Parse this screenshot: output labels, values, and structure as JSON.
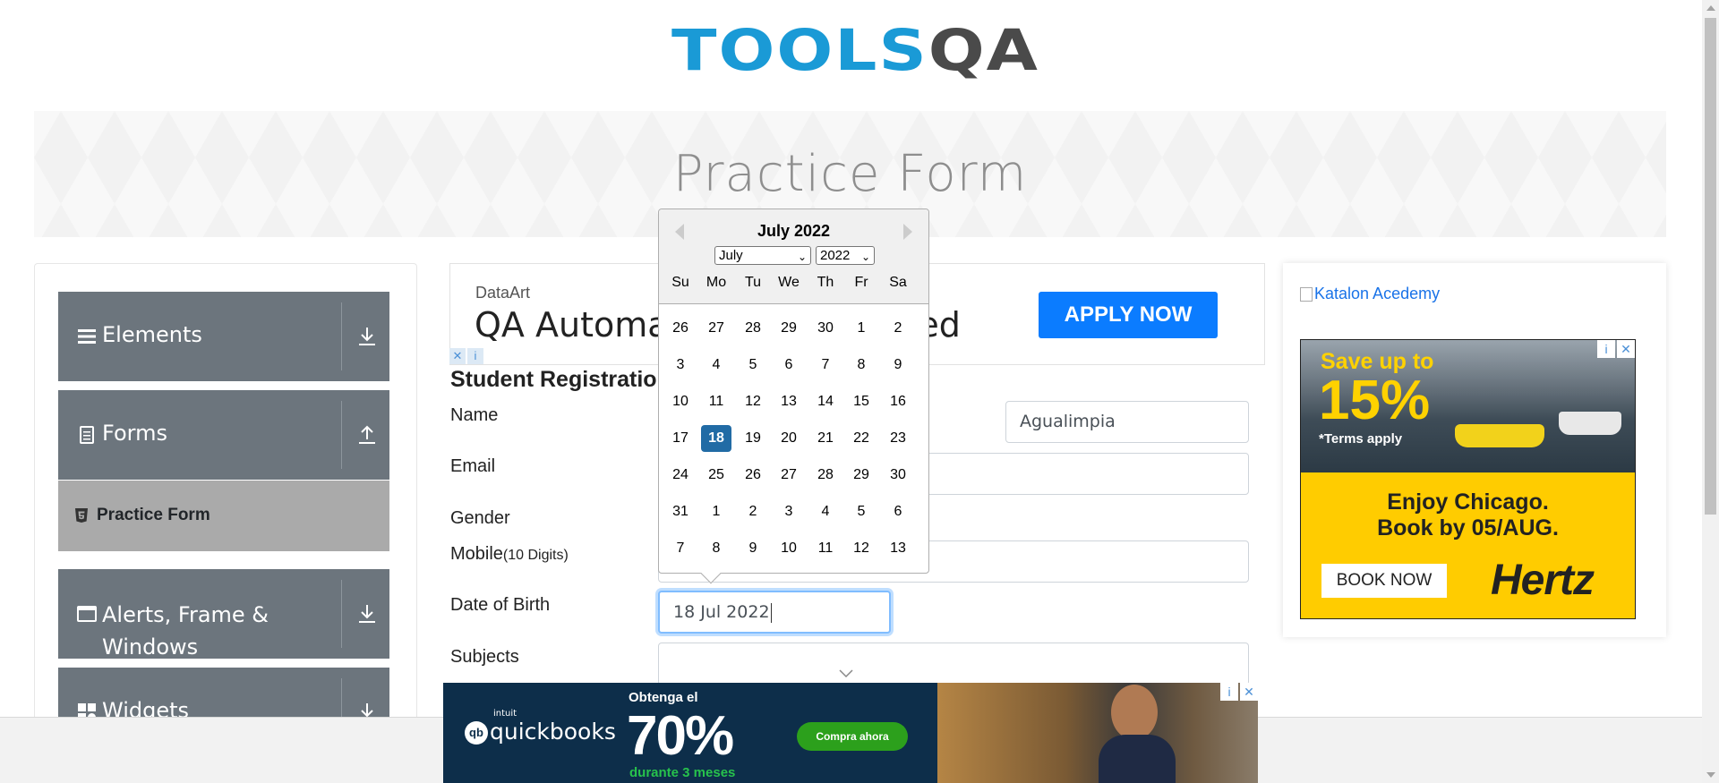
{
  "logo": {
    "text_a": "TOOLS",
    "text_b": "QA"
  },
  "banner": {
    "title": "Practice Form"
  },
  "sidebar": {
    "groups": [
      {
        "label": "Elements",
        "icon": "hamburger-icon",
        "state": "collapsed"
      },
      {
        "label": "Forms",
        "icon": "document-icon",
        "state": "expanded"
      },
      {
        "label": "Alerts, Frame & Windows",
        "label_line1": "Alerts, Frame &",
        "label_line2": "Windows",
        "icon": "window-icon",
        "state": "collapsed"
      },
      {
        "label": "Widgets",
        "icon": "widgets-icon",
        "state": "collapsed"
      }
    ],
    "active_item": {
      "label": "Practice Form",
      "icon": "html5-icon"
    }
  },
  "top_ad": {
    "brand": "DataArt",
    "headline_left": "QA Automat",
    "headline_right": "nted",
    "cta": "APPLY NOW",
    "adchoices": [
      "✕",
      "i"
    ]
  },
  "form": {
    "title": "Student Registration",
    "labels": {
      "name": "Name",
      "email": "Email",
      "gender": "Gender",
      "mobile": "Mobile",
      "mobile_hint": "(10 Digits)",
      "dob": "Date of Birth",
      "subjects": "Subjects"
    },
    "values": {
      "last_name": "Agualimpia",
      "dob": "18 Jul 2022"
    }
  },
  "calendar": {
    "header": "July 2022",
    "month_select": "July",
    "year_select": "2022",
    "weekdays": [
      "Su",
      "Mo",
      "Tu",
      "We",
      "Th",
      "Fr",
      "Sa"
    ],
    "weeks": [
      [
        "26",
        "27",
        "28",
        "29",
        "30",
        "1",
        "2"
      ],
      [
        "3",
        "4",
        "5",
        "6",
        "7",
        "8",
        "9"
      ],
      [
        "10",
        "11",
        "12",
        "13",
        "14",
        "15",
        "16"
      ],
      [
        "17",
        "18",
        "19",
        "20",
        "21",
        "22",
        "23"
      ],
      [
        "24",
        "25",
        "26",
        "27",
        "28",
        "29",
        "30"
      ],
      [
        "31",
        "1",
        "2",
        "3",
        "4",
        "5",
        "6"
      ],
      [
        "7",
        "8",
        "9",
        "10",
        "11",
        "12",
        "13"
      ]
    ],
    "selected_day": "18",
    "accent_color": "#216ba5"
  },
  "right_ad": {
    "broken_image_alt": "Katalon Acedemy",
    "save": "Save up to",
    "percent": "15%",
    "terms": "*Terms apply",
    "line1": "Enjoy Chicago.",
    "line2": "Book by 05/AUG.",
    "cta": "BOOK NOW",
    "brand": "Hertz",
    "adchoices": [
      "i",
      "✕"
    ]
  },
  "bottom_ad": {
    "intuit": "intuit",
    "brand": "quickbooks",
    "obtenga": "Obtenga el",
    "percent": "70%",
    "durante": "durante 3 meses",
    "cta": "Compra ahora",
    "adchoices": [
      "i",
      "✕"
    ]
  },
  "colors": {
    "sidebar_group": "#6c757d",
    "active_item": "#aaaaaa",
    "apply_button": "#0b7cff",
    "logo_blue": "#1a9ad6"
  }
}
